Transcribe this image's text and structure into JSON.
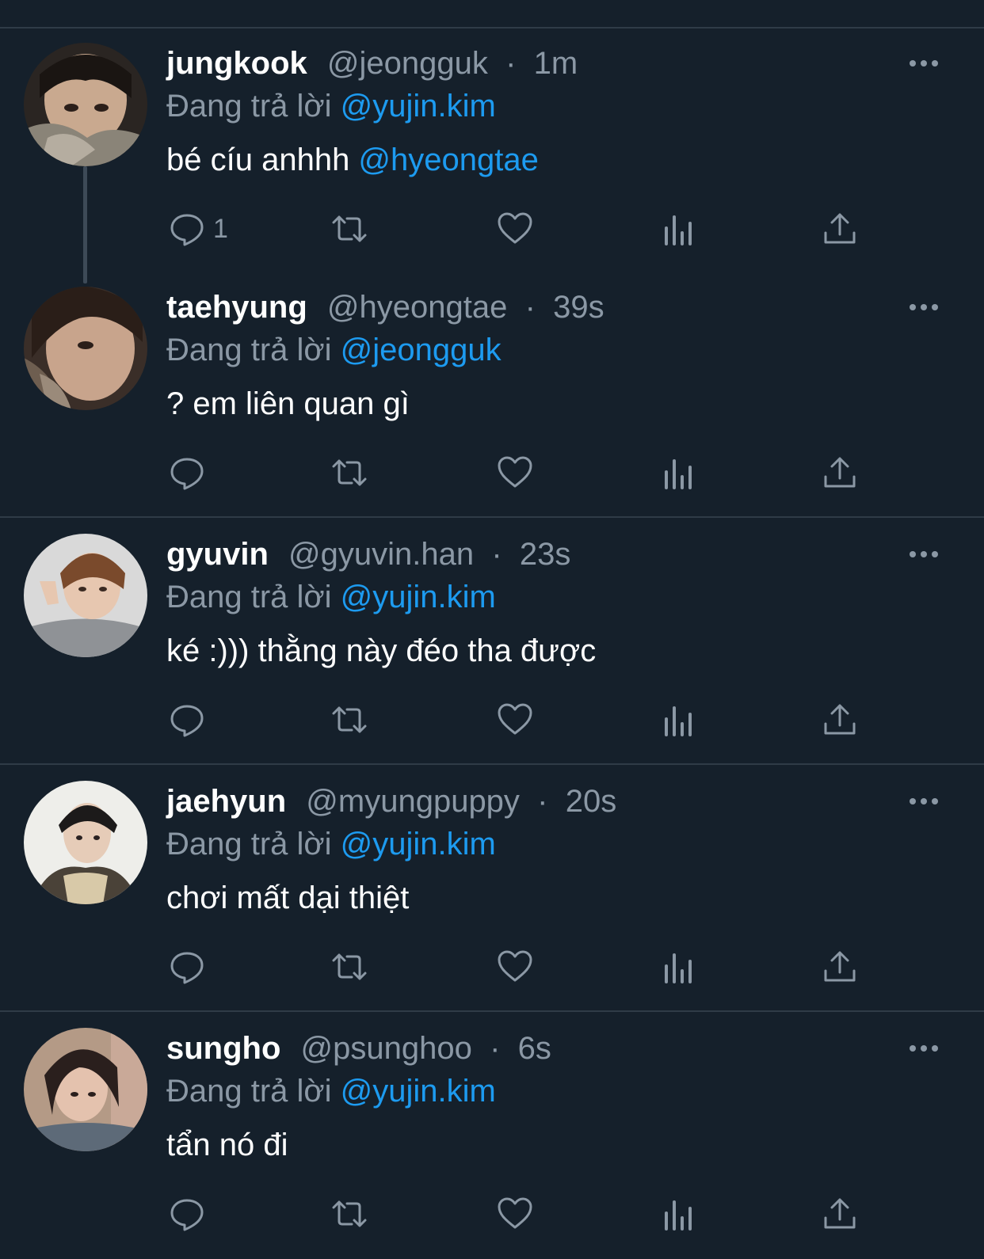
{
  "reply_prefix": "Đang trả lời",
  "separator": "·",
  "tweets": [
    {
      "display_name": "jungkook",
      "handle": "@jeongguk",
      "time": "1m",
      "reply_to": "@yujin.kim",
      "text": "bé cíu anhhh ",
      "text_mention": "@hyeongtae",
      "reply_count": "1",
      "avatar": "avatar-jungkook"
    },
    {
      "display_name": "taehyung",
      "handle": "@hyeongtae",
      "time": "39s",
      "reply_to": "@jeongguk",
      "text": "? em liên quan gì",
      "text_mention": "",
      "reply_count": "",
      "avatar": "avatar-taehyung"
    },
    {
      "display_name": "gyuvin",
      "handle": "@gyuvin.han",
      "time": "23s",
      "reply_to": "@yujin.kim",
      "text": "ké :))) thằng này đéo tha được",
      "text_mention": "",
      "reply_count": "",
      "avatar": "avatar-gyuvin"
    },
    {
      "display_name": "jaehyun",
      "handle": "@myungpuppy",
      "time": "20s",
      "reply_to": "@yujin.kim",
      "text": "chơi mất dại thiệt",
      "text_mention": "",
      "reply_count": "",
      "avatar": "avatar-jaehyun"
    },
    {
      "display_name": "sungho",
      "handle": "@psunghoo",
      "time": "6s",
      "reply_to": "@yujin.kim",
      "text": "tẩn nó đi",
      "text_mention": "",
      "reply_count": "",
      "avatar": "avatar-sungho"
    }
  ],
  "colors": {
    "background": "#15202b",
    "text": "#ffffff",
    "muted": "#8b98a5",
    "accent": "#1d9bf0",
    "divider": "#2f3b47"
  },
  "icons": {
    "reply": "reply-icon",
    "retweet": "retweet-icon",
    "like": "heart-icon",
    "views": "views-icon",
    "share": "share-icon",
    "more": "more-icon"
  }
}
